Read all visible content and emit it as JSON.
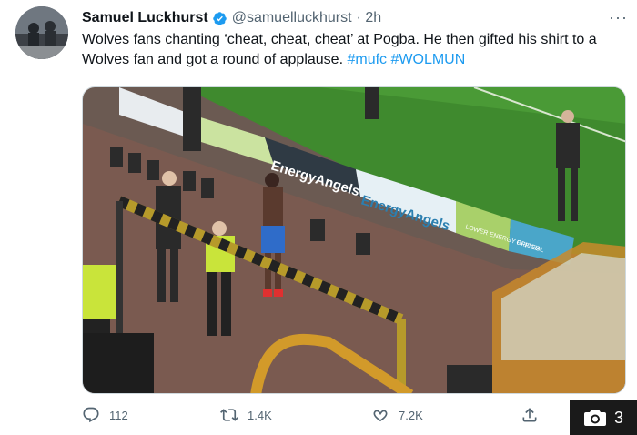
{
  "tweet": {
    "author_name": "Samuel Luckhurst",
    "handle": "@samuelluckhurst",
    "time": "· 2h",
    "more_label": "···",
    "text_main": "Wolves fans chanting ‘cheat, cheat, cheat’ at Pogba. He then gifted his shirt to a Wolves fan and got a round of applause. ",
    "hashtags": [
      "#mufc",
      "#WOLMUN"
    ]
  },
  "actions": {
    "reply_count": "112",
    "retweet_count": "1.4K",
    "like_count": "7.2K"
  },
  "media": {
    "ad_boards": [
      "EnergyAngels",
      "EnergyAngels",
      "LOWER ENERGY PRICES",
      "OFFICIAL"
    ]
  },
  "photo_badge": {
    "count": "3"
  },
  "colors": {
    "link": "#1d9bf0",
    "pitch": "#3f8a2e",
    "verified": "#1d9bf0"
  },
  "icons": [
    "verified-icon",
    "more-icon",
    "reply-icon",
    "retweet-icon",
    "like-icon",
    "share-icon",
    "camera-icon"
  ]
}
